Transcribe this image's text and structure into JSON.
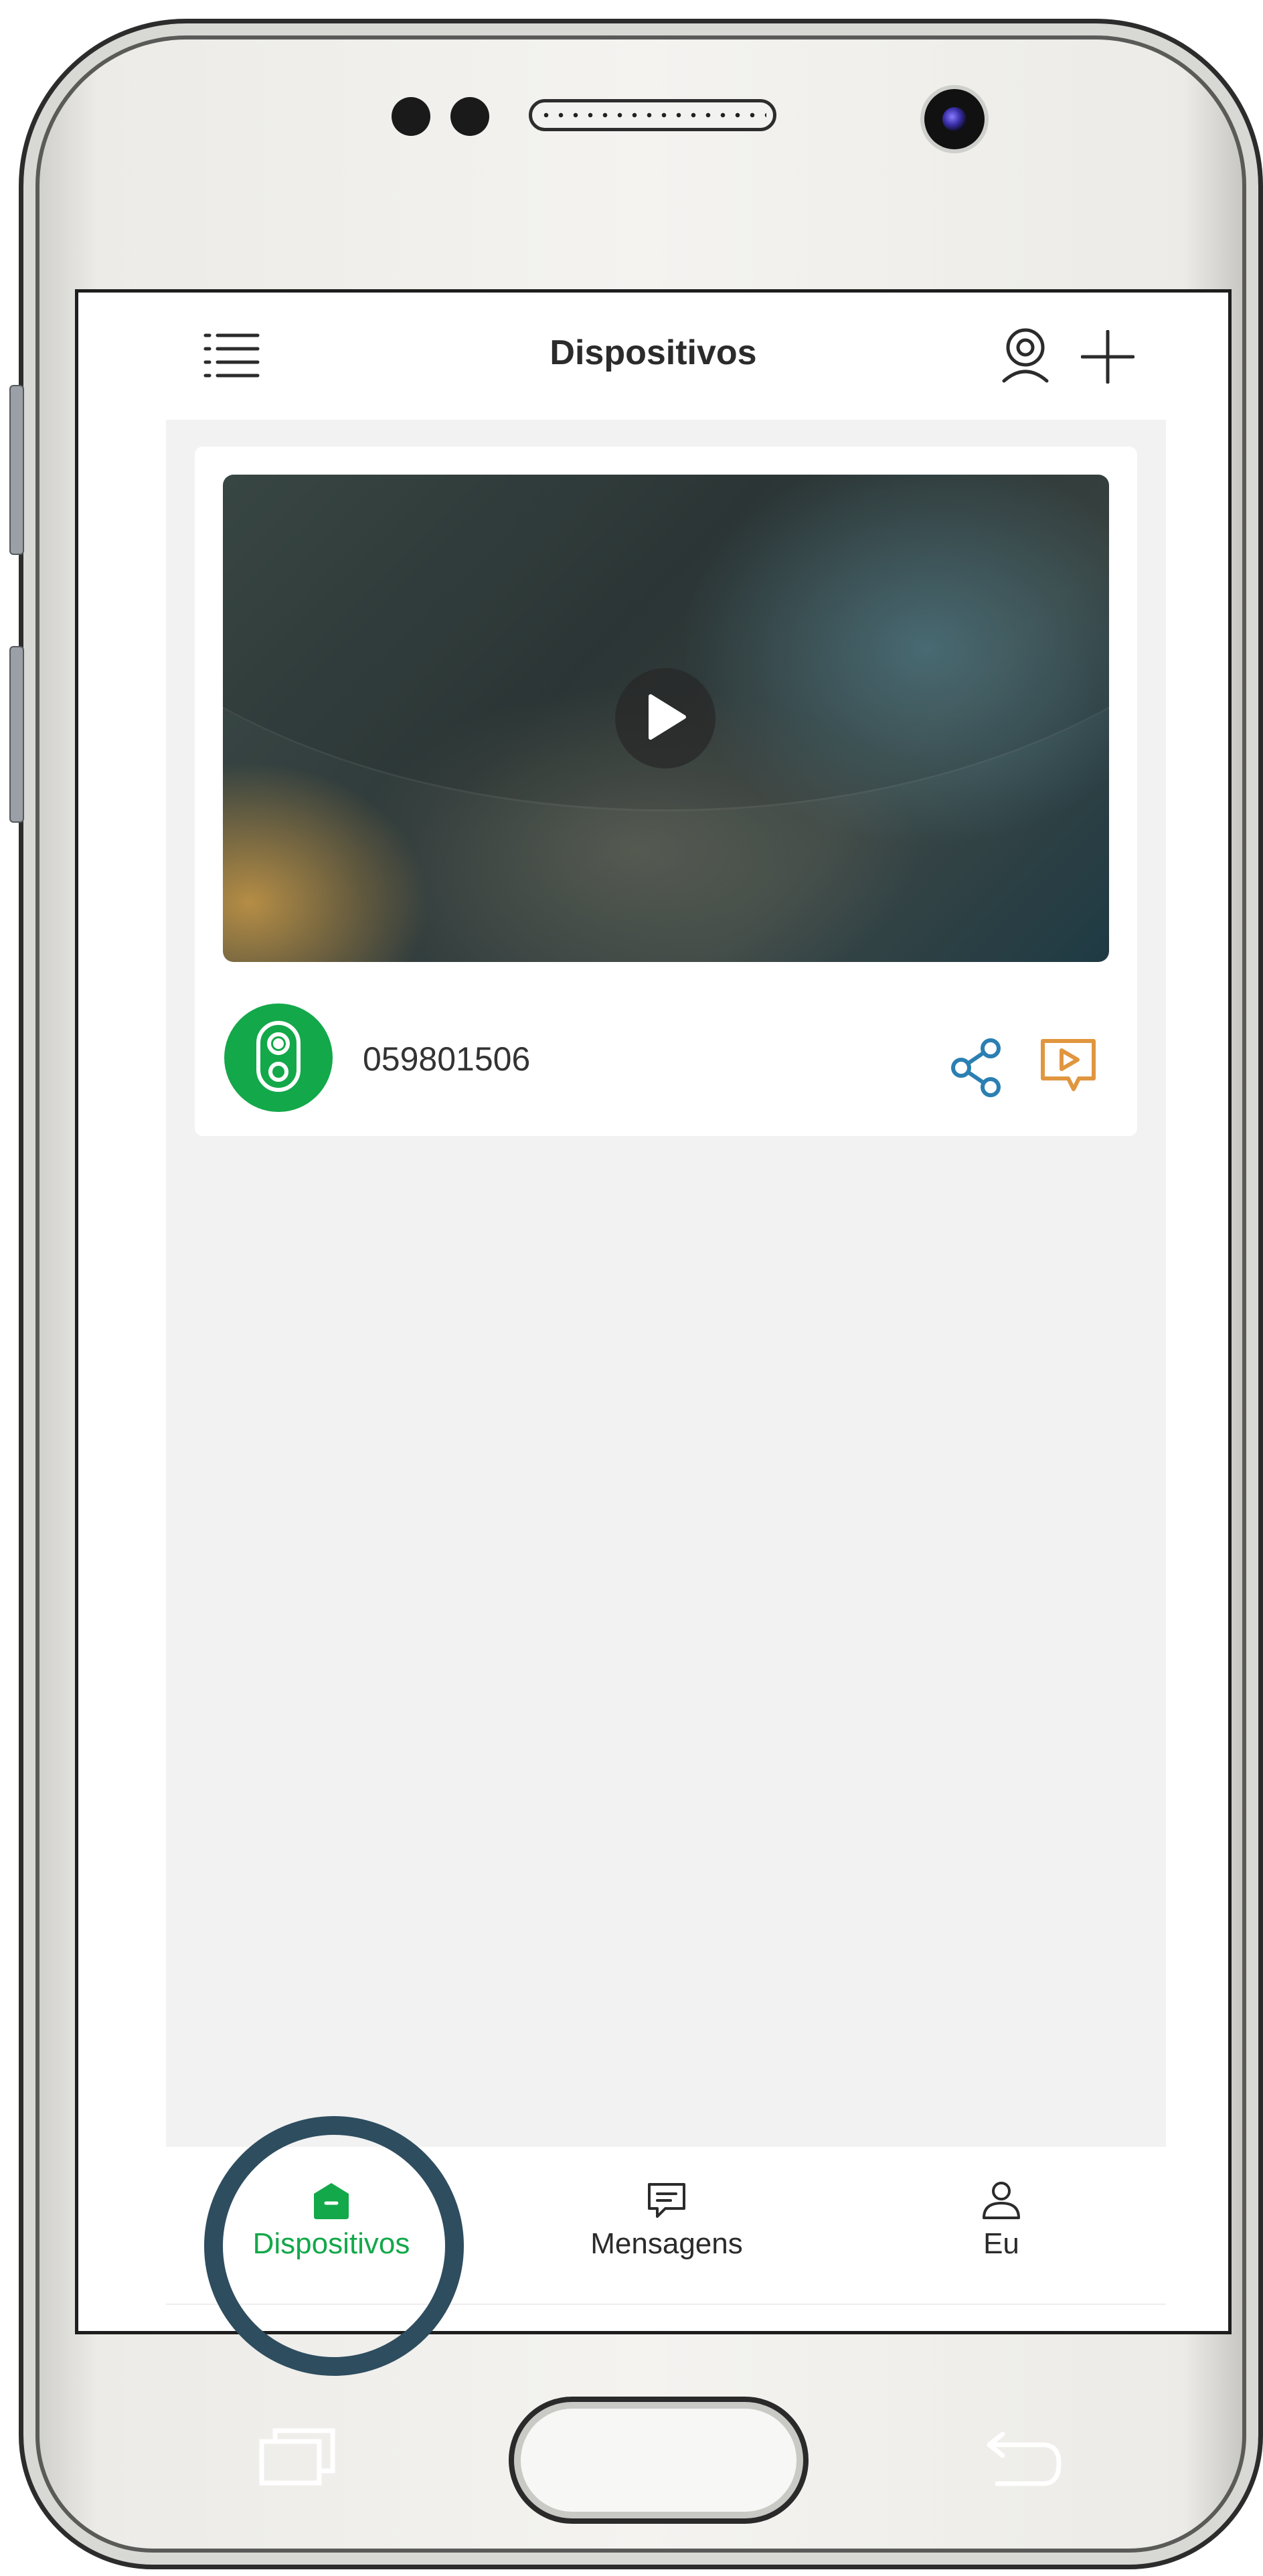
{
  "header": {
    "title": "Dispositivos",
    "menu_icon": "list-menu-icon",
    "camera_user_icon": "camera-user-icon",
    "add_icon": "plus-icon"
  },
  "device_card": {
    "device_id": "059801506",
    "play_icon": "play-icon",
    "device_icon": "doorbell-icon",
    "share_icon": "share-icon",
    "playback_icon": "video-playback-icon"
  },
  "bottom_nav": {
    "items": [
      {
        "label": "Dispositivos",
        "icon": "home-icon",
        "active": true
      },
      {
        "label": "Mensagens",
        "icon": "message-icon",
        "active": false
      },
      {
        "label": "Eu",
        "icon": "user-icon",
        "active": false
      }
    ]
  },
  "colors": {
    "brand_green": "#13a84a",
    "share_blue": "#2b7fb2",
    "playback_orange": "#e0963f",
    "highlight_ring": "#2e4d5f",
    "content_background": "#f2f2f2"
  }
}
